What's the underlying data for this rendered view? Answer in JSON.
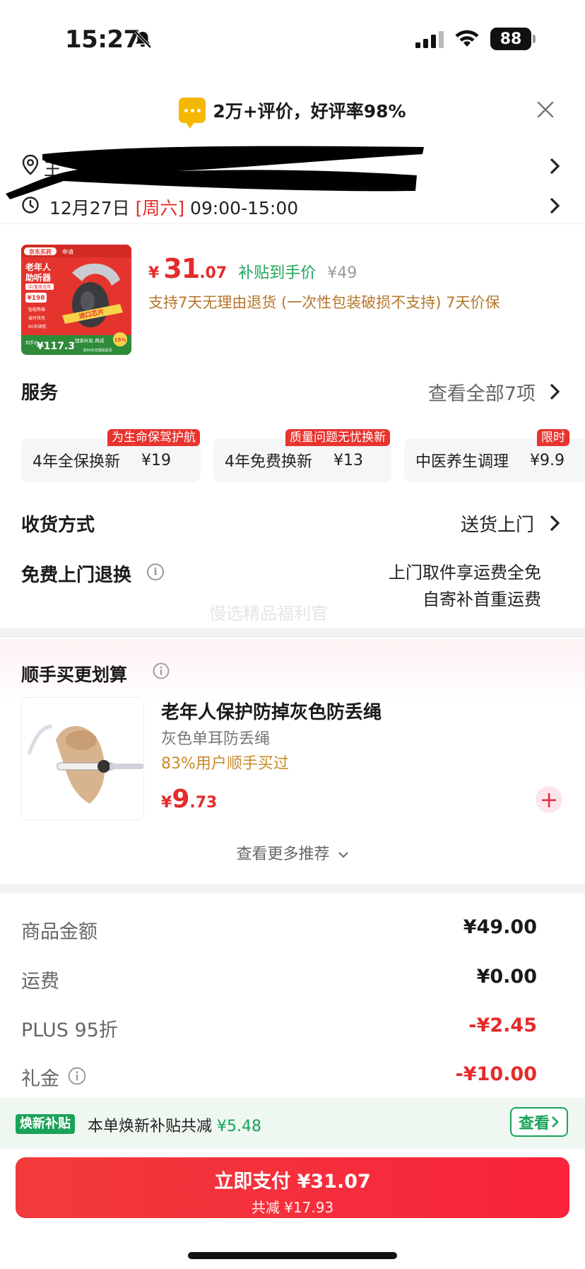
{
  "status_bar": {
    "time": "15:27",
    "battery": "88"
  },
  "banner": {
    "review_text": "2万+评价，好评率98%"
  },
  "address": {
    "text": "王",
    "delivery_date": "12月27日",
    "weekday": "[周六]",
    "window": "09:00-15:00"
  },
  "product": {
    "price_yen": "¥",
    "price_int": "31",
    "price_dec": ".07",
    "subsidy_label": "补贴到手价",
    "original_price": "¥49",
    "return_policy": "支持7天无理由退货 (一次性包装破损不支持)  7天价保",
    "img": {
      "brand": "京东买药",
      "badge": "申请",
      "title": "老年人\n助听器",
      "subtitle": "中/重度适用",
      "price_tag": "¥198",
      "features": [
        "智能降噪",
        "省时快充",
        "60天续航"
      ],
      "chip": "进口芯片",
      "bottom_label": "国家补贴 再减",
      "bottom_price": "¥117.3",
      "pct": "15%",
      "bottom_note": "享90天无理由退货"
    }
  },
  "services": {
    "title": "服务",
    "view_all": "查看全部7项",
    "cards": [
      {
        "name": "4年全保换新",
        "price": "¥19",
        "tag": "为生命保驾护航"
      },
      {
        "name": "4年免费换新",
        "price": "¥13",
        "tag": "质量问题无忧换新"
      },
      {
        "name": "中医养生调理",
        "price": "¥9.9",
        "tag": "限时"
      }
    ]
  },
  "shipping": {
    "title": "收货方式",
    "value": "送货上门"
  },
  "free_return": {
    "title": "免费上门退换",
    "info_icon": "i",
    "line1": "上门取件享运费全免",
    "line2": "自寄补首重运费",
    "watermark": "慢选精品福利官"
  },
  "upsell": {
    "title": "顺手买更划算",
    "item": {
      "name": "老年人保护防掉灰色防丢绳",
      "sub": "灰色单耳防丢绳",
      "percent": "83%用户顺手买过",
      "price_yen": "¥",
      "price_int": "9",
      "price_dec": ".73",
      "plus": "+"
    },
    "more": "查看更多推荐"
  },
  "totals": [
    {
      "label": "商品金额",
      "value": "¥49.00",
      "red": false
    },
    {
      "label": "运费",
      "value": "¥0.00",
      "red": false
    },
    {
      "label": "PLUS 95折",
      "value": "-¥2.45",
      "red": true
    },
    {
      "label": "礼金",
      "value": "-¥10.00",
      "red": true
    }
  ],
  "subsidy_bar": {
    "badge": "焕新补贴",
    "text": "本单焕新补贴共减",
    "amount": "¥5.48",
    "button": "查看"
  },
  "pay": {
    "label": "立即支付 ¥31.07",
    "saved": "共减 ¥17.93"
  },
  "colors": {
    "accent_red": "#e52b2b",
    "green": "#19a359",
    "gold": "#b5762b"
  }
}
